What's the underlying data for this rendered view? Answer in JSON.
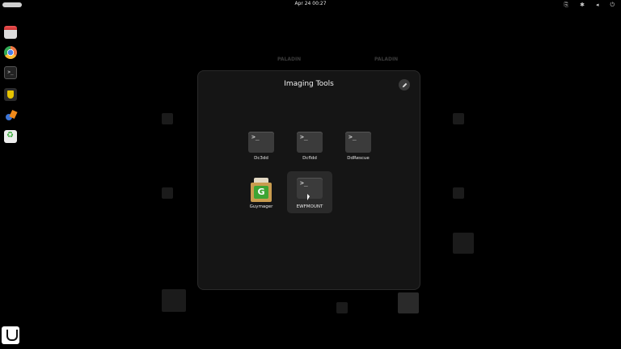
{
  "topbar": {
    "clock": "Apr 24  00:27",
    "tray_icons": [
      "network-icon",
      "bluetooth-icon",
      "volume-icon",
      "power-icon"
    ]
  },
  "dock": {
    "items": [
      "files",
      "chrome",
      "terminal",
      "shield-app",
      "tools",
      "trash"
    ]
  },
  "folder": {
    "title": "Imaging Tools",
    "apps": [
      {
        "name": "Dc3dd",
        "icon": "terminal-icon"
      },
      {
        "name": "Dcfldd",
        "icon": "terminal-icon"
      },
      {
        "name": "DdRescue",
        "icon": "terminal-icon"
      },
      {
        "name": "Guymager",
        "icon": "guymager-icon"
      },
      {
        "name": "EWFMOUNT",
        "icon": "terminal-icon"
      }
    ]
  }
}
